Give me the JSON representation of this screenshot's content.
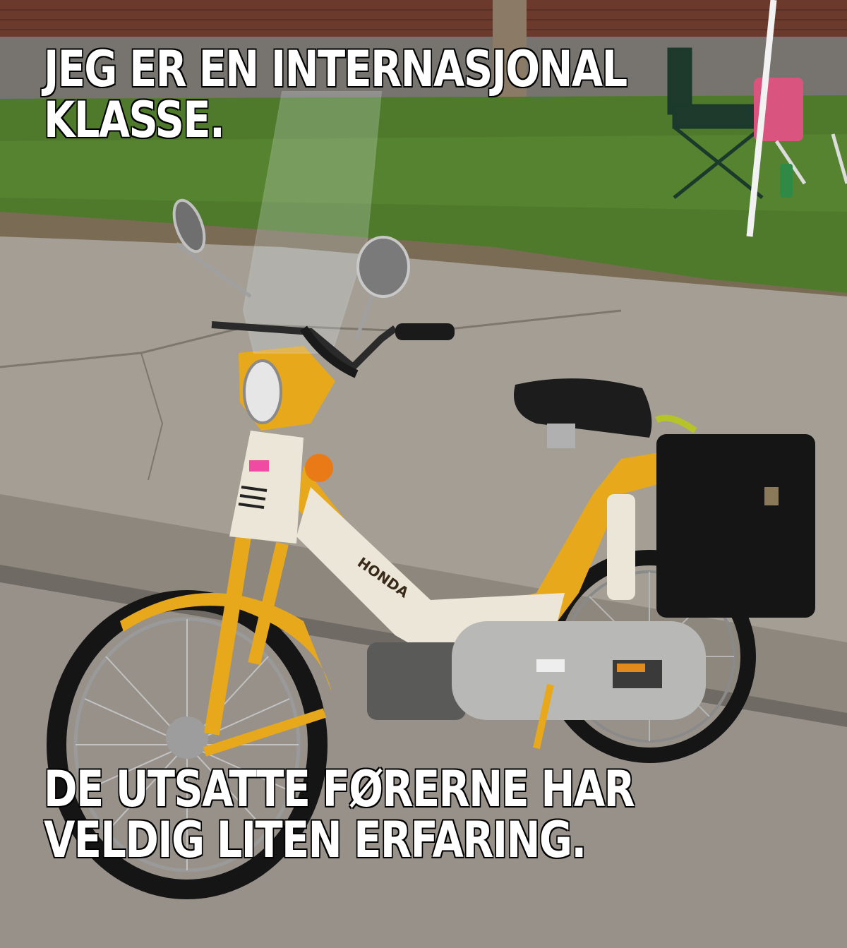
{
  "meme": {
    "top_text": [
      "JEG ER EN INTERNASJONAL",
      "KLASSE."
    ],
    "bottom_text": [
      "DE UTSATTE FØRERNE HAR",
      "VELDIG LITEN ERFARING."
    ]
  },
  "photo": {
    "subject": "yellow-moped",
    "colors": {
      "frame": "#e8a81c",
      "panel": "#ece6d8",
      "seat": "#1c1c1c",
      "bag": "#151515",
      "pavement": "#9c968d",
      "grass": "#4f7a2c",
      "wall": "#6e3a2c"
    }
  }
}
